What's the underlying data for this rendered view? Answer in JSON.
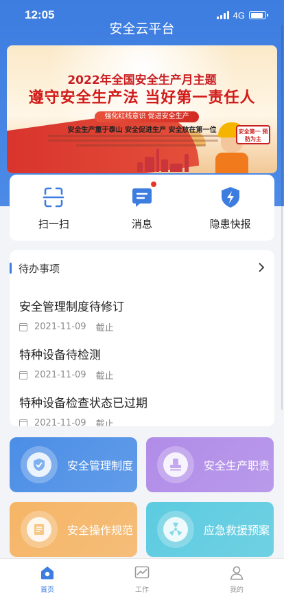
{
  "status_bar": {
    "time": "12:05",
    "network": "4G",
    "battery_level": 0.85
  },
  "app": {
    "title": "安全云平台"
  },
  "banner": {
    "title": "2022年全国安全生产月主题",
    "slogan": "遵守安全生产法 当好第一责任人",
    "ribbon": "强化红线意识 促进安全生产",
    "line": "安全生产重于泰山 安全促进生产 安全放在第一位",
    "stamp": "安全第一 预防为主"
  },
  "quick_actions": [
    {
      "label": "扫一扫",
      "icon": "scan-icon",
      "badge": false
    },
    {
      "label": "消息",
      "icon": "message-icon",
      "badge": true
    },
    {
      "label": "隐患快报",
      "icon": "hazard-shield-icon",
      "badge": false
    }
  ],
  "todo": {
    "title": "待办事项",
    "items": [
      {
        "title": "安全管理制度待修订",
        "date": "2021-11-09",
        "status": "截止"
      },
      {
        "title": "特种设备待检测",
        "date": "2021-11-09",
        "status": "截止"
      },
      {
        "title": "特种设备检查状态已过期",
        "date": "2021-11-09",
        "status": "截止"
      }
    ]
  },
  "tiles": [
    {
      "label": "安全管理制度",
      "icon": "shield-check-icon",
      "color": "#4b8ee6"
    },
    {
      "label": "安全生产职责",
      "icon": "stamp-icon",
      "color": "#b08ce8"
    },
    {
      "label": "安全操作规范",
      "icon": "document-icon",
      "color": "#f5b566"
    },
    {
      "label": "应急救援预案",
      "icon": "radiation-icon",
      "color": "#5ccbe0"
    }
  ],
  "bottom_nav": [
    {
      "label": "首页",
      "icon": "home-icon",
      "active": true
    },
    {
      "label": "工作",
      "icon": "chart-icon",
      "active": false
    },
    {
      "label": "我的",
      "icon": "user-icon",
      "active": false
    }
  ]
}
